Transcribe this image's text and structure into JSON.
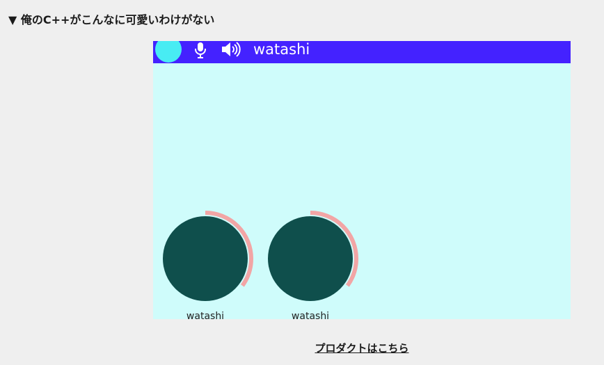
{
  "heading": "▼ 俺のC++がこんなに可愛いわけがない",
  "widget": {
    "topbar": {
      "username": "watashi",
      "icons": [
        "avatar",
        "mic-icon",
        "speaker-icon"
      ]
    },
    "participants": [
      {
        "name": "watashi",
        "level": 0.35
      },
      {
        "name": "watashi",
        "level": 0.35
      }
    ],
    "colors": {
      "topbar": "#4422ff",
      "background": "#cffcfb",
      "self_avatar": "#48ecf3",
      "participant_avatar": "#0f4f4c",
      "level_ring": "#f2a5a5"
    }
  },
  "footer": {
    "link_label": "プロダクトはこちら"
  }
}
